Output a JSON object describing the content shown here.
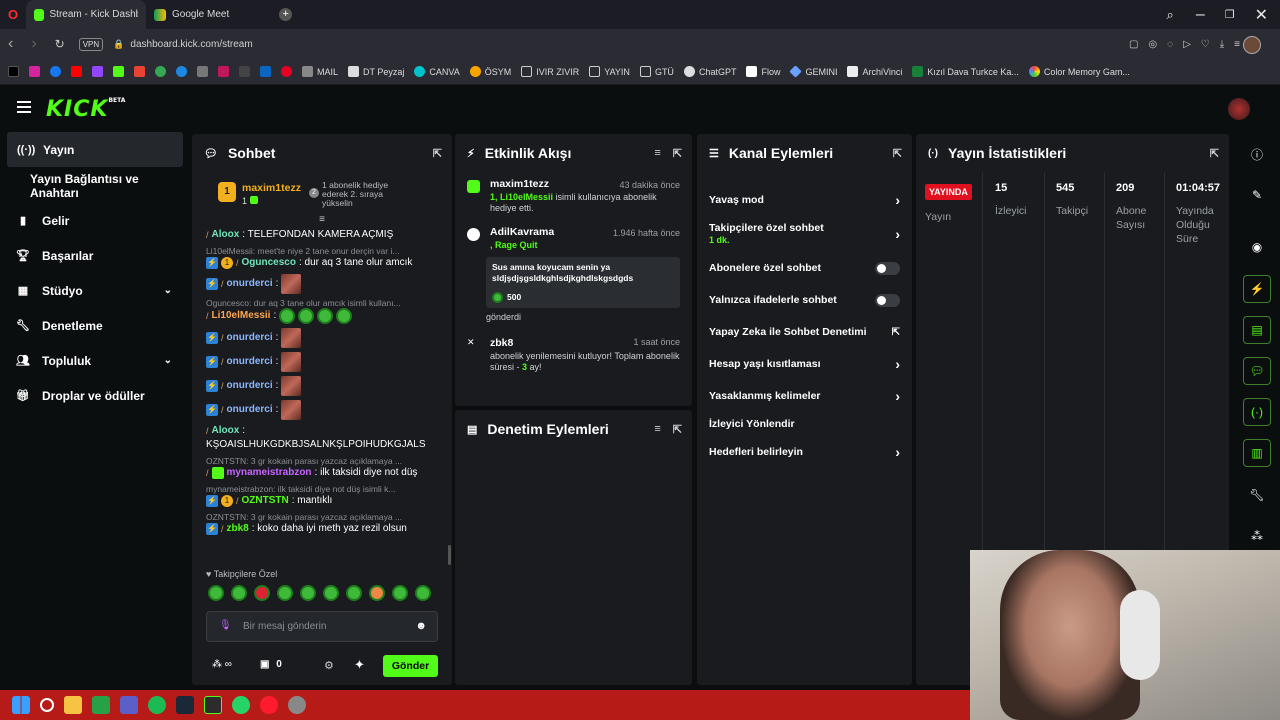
{
  "browser": {
    "tabs": [
      {
        "label": "Stream - Kick Dashboard"
      },
      {
        "label": "Google Meet"
      }
    ],
    "url": "dashboard.kick.com/stream",
    "vpn": "VPN",
    "bookmarks": [
      "MAIL",
      "DT Peyzaj",
      "CANVA",
      "ÖSYM",
      "IVIR ZIVIR",
      "YAYIN",
      "GTÜ",
      "ChatGPT",
      "Flow",
      "GEMINI",
      "ArchiVinci",
      "Kızıl Dava Turkce Ka...",
      "Color Memory Gam..."
    ]
  },
  "kick": {
    "logo": "KICK",
    "beta": "BETA"
  },
  "sidebar": {
    "items": [
      {
        "label": "Yayın",
        "icon": "broadcast-icon"
      },
      {
        "label": "Yayın Bağlantısı ve Anahtarı"
      },
      {
        "label": "Gelir",
        "icon": "chart-icon"
      },
      {
        "label": "Başarılar",
        "icon": "trophy-icon"
      },
      {
        "label": "Stüdyo",
        "icon": "grid-icon"
      },
      {
        "label": "Denetleme",
        "icon": "wrench-icon"
      },
      {
        "label": "Topluluk",
        "icon": "people-icon"
      },
      {
        "label": "Droplar ve ödüller",
        "icon": "gift-icon"
      }
    ]
  },
  "chat": {
    "title": "Sohbet",
    "pinned_user": "maxim1tezz",
    "pinned_count": "1",
    "pinned_note": "1 abonelik hediye ederek 2. sıraya yükselin",
    "messages": {
      "m1_user": "Aloox",
      "m1_text": ": TELEFONDAN KAMERA AÇMIŞ",
      "m2_reply": "Li10elMessii: meet'te niye 2 tane onur derçin var i...",
      "m2_user": "Oguncesco",
      "m2_text": ": dur aq 3 tane olur amcık",
      "m3_user": "onurderci",
      "m3_text": ":",
      "m4_reply": "Oguncesco: dur aq 3 tane olur amcık isimli kullanı...",
      "m4_user": "Li10elMessii",
      "m4_text": ":",
      "m5_user": "onurderci",
      "m5_text": ":",
      "m6_user": "onurderci",
      "m6_text": ":",
      "m7_user": "onurderci",
      "m7_text": ":",
      "m8_user": "onurderci",
      "m8_text": ":",
      "m9_user": "Aloox",
      "m9_text": ":",
      "m9_body": "KŞOAISLHUKGDKBJSALNKŞLPOIHUDKGJALS",
      "m10_reply": "OZNTSTN: 3 gr kokain parası yazcaz açıklamaya ...",
      "m10_user": "mynameistrabzon",
      "m10_text": ": ilk taksidi diye not düş",
      "m11_reply": "mynameistrabzon: ilk taksidi diye not düş isimli k...",
      "m11_user": "OZNTSTN",
      "m11_text": ": mantıklı",
      "m12_reply": "OZNTSTN: 3 gr kokain parası yazcaz açıklamaya ...",
      "m12_user": "zbk8",
      "m12_text": ": koko daha iyi meth yaz rezil olsun"
    },
    "emote_section": "Takipçilere Özel",
    "input_placeholder": "Bir mesaj gönderin",
    "viewers_symbol": "∞",
    "points": "0",
    "send": "Gönder"
  },
  "activity": {
    "title": "Etkinlik Akışı",
    "items": [
      {
        "user": "maxim1tezz",
        "time": "43 dakika önce",
        "hl": "1, Li10elMessii",
        "text": " isimli kullanıcıya abonelik hediye etti."
      },
      {
        "user": "AdilKavrama",
        "time": "1.946 hafta önce",
        "hl": ", Rage Quit",
        "text": "",
        "quote": "Sus amına koyucam senin ya sldjşdjşgsldkghlsdjkghdlskgsdgds",
        "amount": "500",
        "after": "gönderdi"
      },
      {
        "user": "zbk8",
        "time": "1 saat önce",
        "text": "abonelik yenilemesini kutluyor! Toplam abonelik süresi - ",
        "hl": "3",
        "tail": " ay!"
      }
    ]
  },
  "moderation": {
    "title": "Denetim Eylemleri"
  },
  "channel": {
    "title": "Kanal Eylemleri",
    "items": [
      {
        "label": "Yavaş mod"
      },
      {
        "label": "Takipçilere özel sohbet",
        "sub": "1 dk."
      },
      {
        "label": "Abonelere özel sohbet"
      },
      {
        "label": "Yalnızca ifadelerle sohbet"
      },
      {
        "label": "Yapay Zeka ile Sohbet Denetimi"
      },
      {
        "label": "Hesap yaşı kısıtlaması"
      },
      {
        "label": "Yasaklanmış kelimeler"
      },
      {
        "label": "İzleyici Yönlendir"
      },
      {
        "label": "Hedefleri belirleyin"
      }
    ]
  },
  "stats": {
    "title": "Yayın İstatistikleri",
    "live": "YAYINDA",
    "live_label": "Yayın",
    "viewers": "15",
    "viewers_label": "İzleyici",
    "followers": "545",
    "followers_label": "Takipçi",
    "subs": "209",
    "subs_label": "Abone Sayısı",
    "uptime": "01:04:57",
    "uptime_label": "Yayında Olduğu Süre"
  },
  "colors": {
    "brand": "#53fc18",
    "panel": "#191b1f",
    "bg": "#0b0e0f",
    "live": "#e0101e",
    "taskbar": "#b61b18"
  }
}
